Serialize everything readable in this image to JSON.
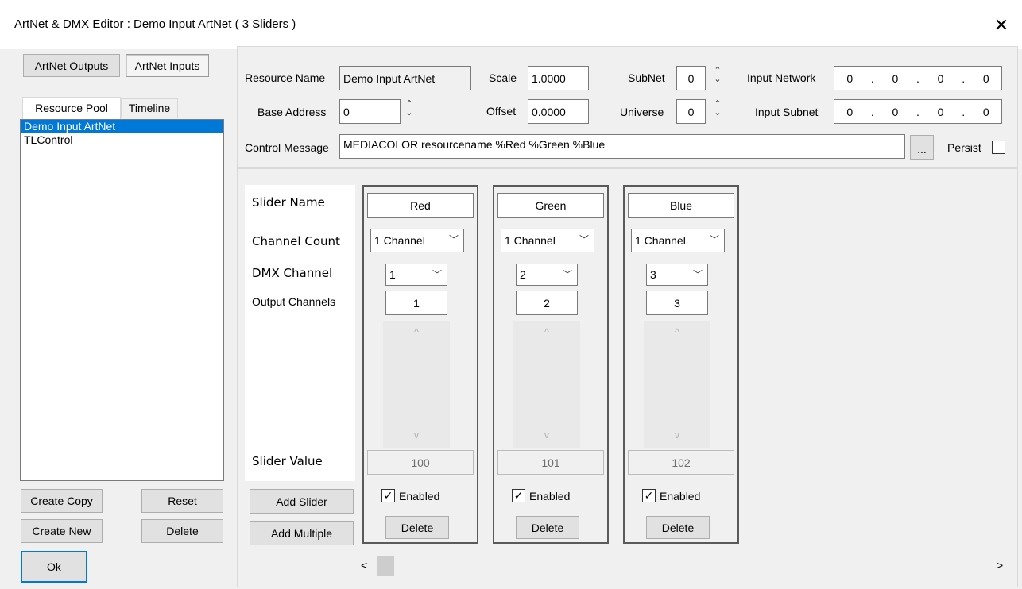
{
  "window": {
    "title": "ArtNet & DMX Editor : Demo Input ArtNet ( 3 Sliders )",
    "close": "✕"
  },
  "mode_tabs": {
    "outputs": "ArtNet Outputs",
    "inputs": "ArtNet Inputs"
  },
  "pool_tabs": {
    "resource_pool": "Resource Pool",
    "timeline": "Timeline"
  },
  "resources": [
    {
      "name": "Demo Input ArtNet",
      "selected": true
    },
    {
      "name": "TLControl",
      "selected": false
    }
  ],
  "left_buttons": {
    "create_copy": "Create Copy",
    "reset": "Reset",
    "create_new": "Create New",
    "delete": "Delete",
    "ok": "Ok"
  },
  "props": {
    "resource_name_label": "Resource Name",
    "resource_name": "Demo Input ArtNet",
    "base_address_label": "Base Address",
    "base_address": "0",
    "scale_label": "Scale",
    "scale": "1.0000",
    "offset_label": "Offset",
    "offset": "0.0000",
    "subnet_label": "SubNet",
    "subnet": "0",
    "universe_label": "Universe",
    "universe": "0",
    "input_network_label": "Input Network",
    "input_network": [
      "0",
      "0",
      "0",
      "0"
    ],
    "input_subnet_label": "Input Subnet",
    "input_subnet": [
      "0",
      "0",
      "0",
      "0"
    ],
    "control_message_label": "Control Message",
    "control_message": "MEDIACOLOR resourcename %Red %Green %Blue",
    "browse": "...",
    "persist_label": "Persist"
  },
  "row_labels": {
    "slider_name": "Slider Name",
    "channel_count": "Channel Count",
    "dmx_channel": "DMX Channel",
    "output_channels": "Output Channels",
    "slider_value": "Slider Value",
    "add_slider": "Add Slider",
    "add_multiple": "Add Multiple"
  },
  "sliders": [
    {
      "name": "Red",
      "channel_count": "1 Channel",
      "dmx_channel": "1",
      "output_channels": "1",
      "value": "100",
      "enabled_label": "Enabled",
      "enabled": true,
      "delete": "Delete"
    },
    {
      "name": "Green",
      "channel_count": "1 Channel",
      "dmx_channel": "2",
      "output_channels": "2",
      "value": "101",
      "enabled_label": "Enabled",
      "enabled": true,
      "delete": "Delete"
    },
    {
      "name": "Blue",
      "channel_count": "1 Channel",
      "dmx_channel": "3",
      "output_channels": "3",
      "value": "102",
      "enabled_label": "Enabled",
      "enabled": true,
      "delete": "Delete"
    }
  ],
  "icons": {
    "spin_up": "⌃",
    "spin_down": "⌄",
    "combo_chevron": "﹀",
    "scroll_left": "<",
    "scroll_right": ">",
    "slider_up": "^",
    "slider_down": "v",
    "check": "✓",
    "ip_dot": "."
  }
}
